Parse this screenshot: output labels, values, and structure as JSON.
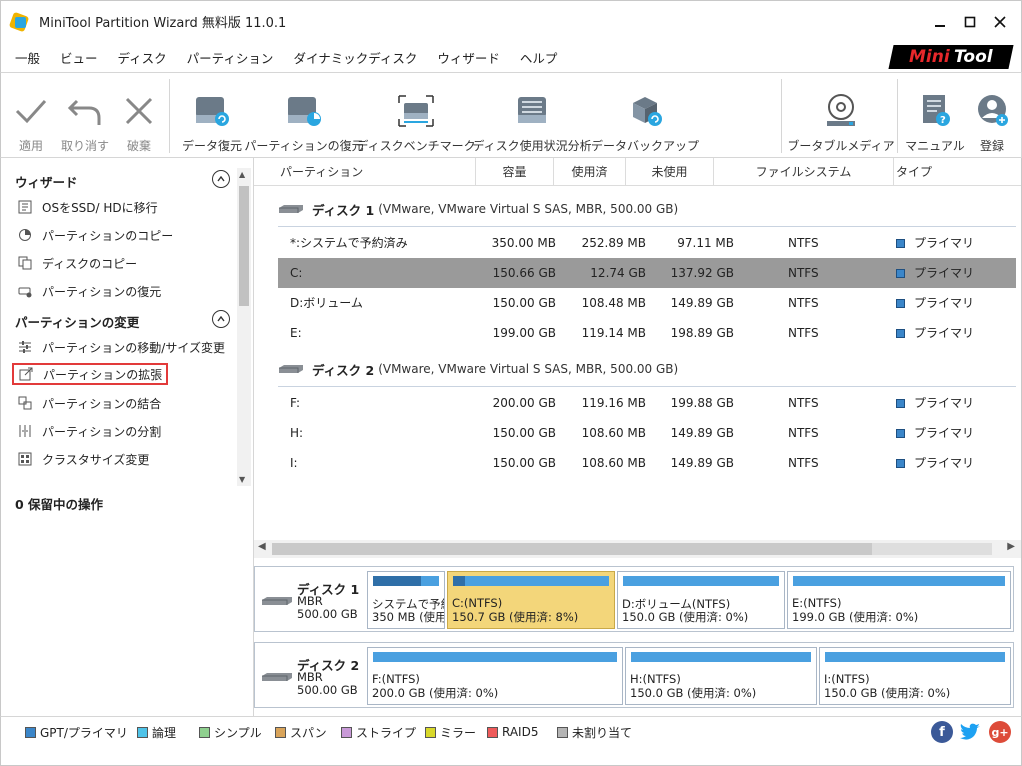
{
  "window": {
    "title": "MiniTool Partition Wizard 無料版 11.0.1",
    "brand_mini": "Mini",
    "brand_tool": "Tool"
  },
  "menu": [
    "一般",
    "ビュー",
    "ディスク",
    "パーティション",
    "ダイナミックディスク",
    "ウィザード",
    "ヘルプ"
  ],
  "toolbar": {
    "apply": "適用",
    "undo": "取り消す",
    "discard": "破棄",
    "data_recovery": "データ復元",
    "partition_recovery": "パーティションの復元",
    "disk_benchmark": "ディスクベンチマーク",
    "space_analyzer": "ディスク使用状況分析",
    "data_backup": "データバックアップ",
    "bootable_media": "ブータブルメディア",
    "manual": "マニュアル",
    "register": "登録"
  },
  "left": {
    "wizard_header": "ウィザード",
    "wizard_items": [
      "OSをSSD/ HDに移行",
      "パーティションのコピー",
      "ディスクのコピー",
      "パーティションの復元"
    ],
    "change_header": "パーティションの変更",
    "change_items": [
      "パーティションの移動/サイズ変更",
      "パーティションの拡張",
      "パーティションの結合",
      "パーティションの分割",
      "クラスタサイズ変更"
    ],
    "pending": "0 保留中の操作"
  },
  "table": {
    "headers": [
      "パーティション",
      "容量",
      "使用済",
      "未使用",
      "ファイルシステム",
      "タイプ"
    ],
    "disk1": {
      "name": "ディスク 1",
      "desc": "(VMware, VMware Virtual S SAS, MBR, 500.00 GB)"
    },
    "disk1_rows": [
      [
        "*:システムで予約済み",
        "350.00 MB",
        "252.89 MB",
        "97.11 MB",
        "NTFS",
        "プライマリ"
      ],
      [
        "C:",
        "150.66 GB",
        "12.74 GB",
        "137.92 GB",
        "NTFS",
        "プライマリ"
      ],
      [
        "D:ボリューム",
        "150.00 GB",
        "108.48 MB",
        "149.89 GB",
        "NTFS",
        "プライマリ"
      ],
      [
        "E:",
        "199.00 GB",
        "119.14 MB",
        "198.89 GB",
        "NTFS",
        "プライマリ"
      ]
    ],
    "disk2": {
      "name": "ディスク 2",
      "desc": "(VMware, VMware Virtual S SAS, MBR, 500.00 GB)"
    },
    "disk2_rows": [
      [
        "F:",
        "200.00 GB",
        "119.16 MB",
        "199.88 GB",
        "NTFS",
        "プライマリ"
      ],
      [
        "H:",
        "150.00 GB",
        "108.60 MB",
        "149.89 GB",
        "NTFS",
        "プライマリ"
      ],
      [
        "I:",
        "150.00 GB",
        "108.60 MB",
        "149.89 GB",
        "NTFS",
        "プライマリ"
      ]
    ]
  },
  "map": {
    "disk1": {
      "name": "ディスク 1",
      "type": "MBR",
      "size": "500.00 GB",
      "parts": [
        {
          "l1": "システムで予約",
          "l2": "350 MB (使用",
          "used_fraction": 0.72
        },
        {
          "l1": "C:(NTFS)",
          "l2": "150.7 GB (使用済: 8%)",
          "used_fraction": 0.08
        },
        {
          "l1": "D:ボリューム(NTFS)",
          "l2": "150.0 GB (使用済: 0%)",
          "used_fraction": 0
        },
        {
          "l1": "E:(NTFS)",
          "l2": "199.0 GB (使用済: 0%)",
          "used_fraction": 0
        }
      ]
    },
    "disk2": {
      "name": "ディスク 2",
      "type": "MBR",
      "size": "500.00 GB",
      "parts": [
        {
          "l1": "F:(NTFS)",
          "l2": "200.0 GB (使用済: 0%)",
          "used_fraction": 0
        },
        {
          "l1": "H:(NTFS)",
          "l2": "150.0 GB (使用済: 0%)",
          "used_fraction": 0
        },
        {
          "l1": "I:(NTFS)",
          "l2": "150.0 GB (使用済: 0%)",
          "used_fraction": 0
        }
      ]
    }
  },
  "legend": [
    {
      "label": "GPT/プライマリ",
      "color": "#3b86c9"
    },
    {
      "label": "論理",
      "color": "#4fc3e8"
    },
    {
      "label": "シンプル",
      "color": "#8fd08f"
    },
    {
      "label": "スパン",
      "color": "#d9a45a"
    },
    {
      "label": "ストライプ",
      "color": "#c99ad8"
    },
    {
      "label": "ミラー",
      "color": "#d8d82a"
    },
    {
      "label": "RAID5",
      "color": "#ee5a5a"
    },
    {
      "label": "未割り当て",
      "color": "#b5b5b5"
    }
  ],
  "colors": {
    "selected_row": "#9a9a9a",
    "selected_partition": "#f3d67a",
    "partition_bar": "#4aa0e0"
  }
}
